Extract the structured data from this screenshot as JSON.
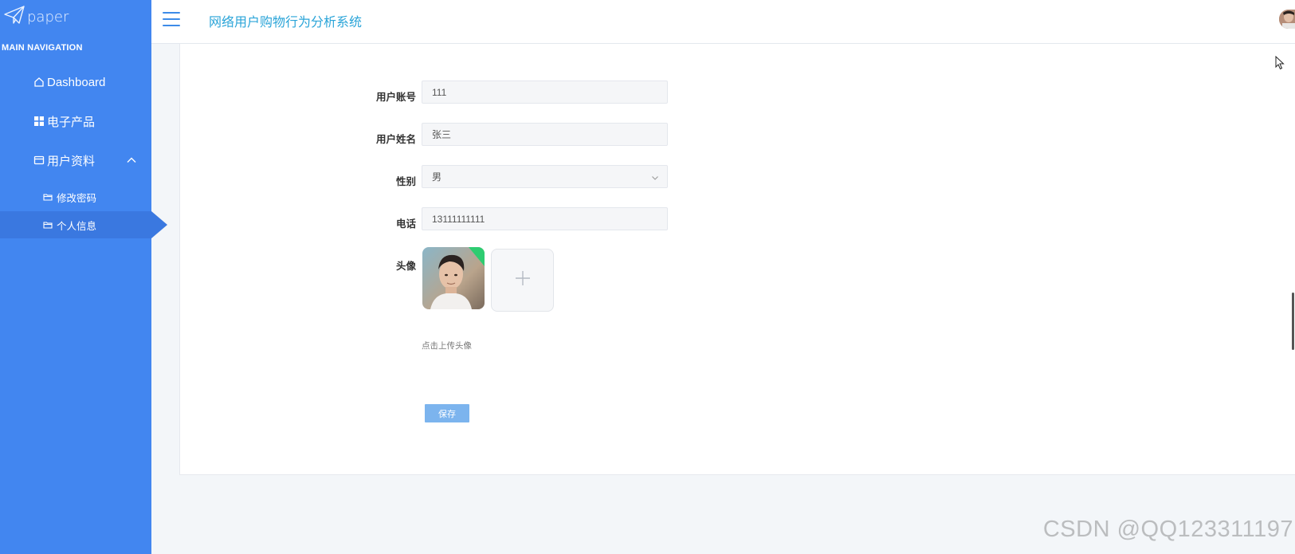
{
  "sidebar": {
    "logo_text": "paper",
    "heading": "MAIN NAVIGATION",
    "items": [
      {
        "label": "Dashboard"
      },
      {
        "label": "电子产品"
      },
      {
        "label": "用户资料"
      }
    ],
    "sub_items": [
      {
        "label": "修改密码"
      },
      {
        "label": "个人信息"
      }
    ]
  },
  "header": {
    "title": "网络用户购物行为分析系统"
  },
  "form": {
    "account": {
      "label": "用户账号",
      "value": "111"
    },
    "name": {
      "label": "用户姓名",
      "value": "张三"
    },
    "gender": {
      "label": "性别",
      "value": "男"
    },
    "phone": {
      "label": "电话",
      "value": "13111111111"
    },
    "avatar": {
      "label": "头像",
      "hint": "点击上传头像"
    },
    "save_label": "保存"
  },
  "watermark": "CSDN @QQ123311197",
  "colors": {
    "sidebar": "#4286f0",
    "sidebar_active": "#3a78e0",
    "title": "#2aa4d8",
    "save_button": "#7cb4ee"
  }
}
